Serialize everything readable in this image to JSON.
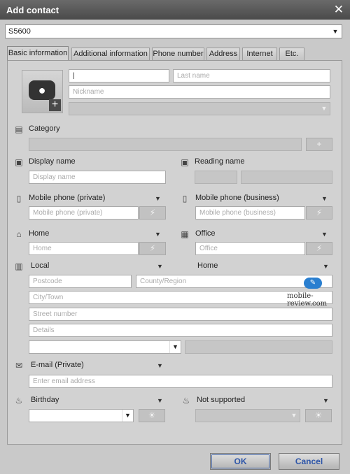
{
  "window": {
    "title": "Add contact"
  },
  "device": {
    "selected": "S5600"
  },
  "tabs": [
    "Basic information",
    "Additional information",
    "Phone number",
    "Address",
    "Internet",
    "Etc."
  ],
  "name": {
    "first_value": "|",
    "last_placeholder": "Last name",
    "nickname_placeholder": "Nickname"
  },
  "category": {
    "label": "Category"
  },
  "display": {
    "label": "Display name",
    "placeholder": "Display name"
  },
  "reading": {
    "label": "Reading name"
  },
  "mobile_private": {
    "label": "Mobile phone (private)",
    "placeholder": "Mobile phone (private)"
  },
  "mobile_business": {
    "label": "Mobile phone (business)",
    "placeholder": "Mobile phone (business)"
  },
  "home_phone": {
    "label": "Home",
    "placeholder": "Home"
  },
  "office_phone": {
    "label": "Office",
    "placeholder": "Office"
  },
  "address": {
    "type_label": "Local",
    "kind_label": "Home",
    "postcode": "Postcode",
    "region": "County/Region",
    "city": "City/Town",
    "street": "Street number",
    "details": "Details"
  },
  "email": {
    "label": "E-mail (Private)",
    "placeholder": "Enter email address"
  },
  "birthday": {
    "label": "Birthday"
  },
  "anniversary": {
    "label": "Not supported"
  },
  "buttons": {
    "ok": "OK",
    "cancel": "Cancel"
  },
  "watermark": "mobile-review.com"
}
